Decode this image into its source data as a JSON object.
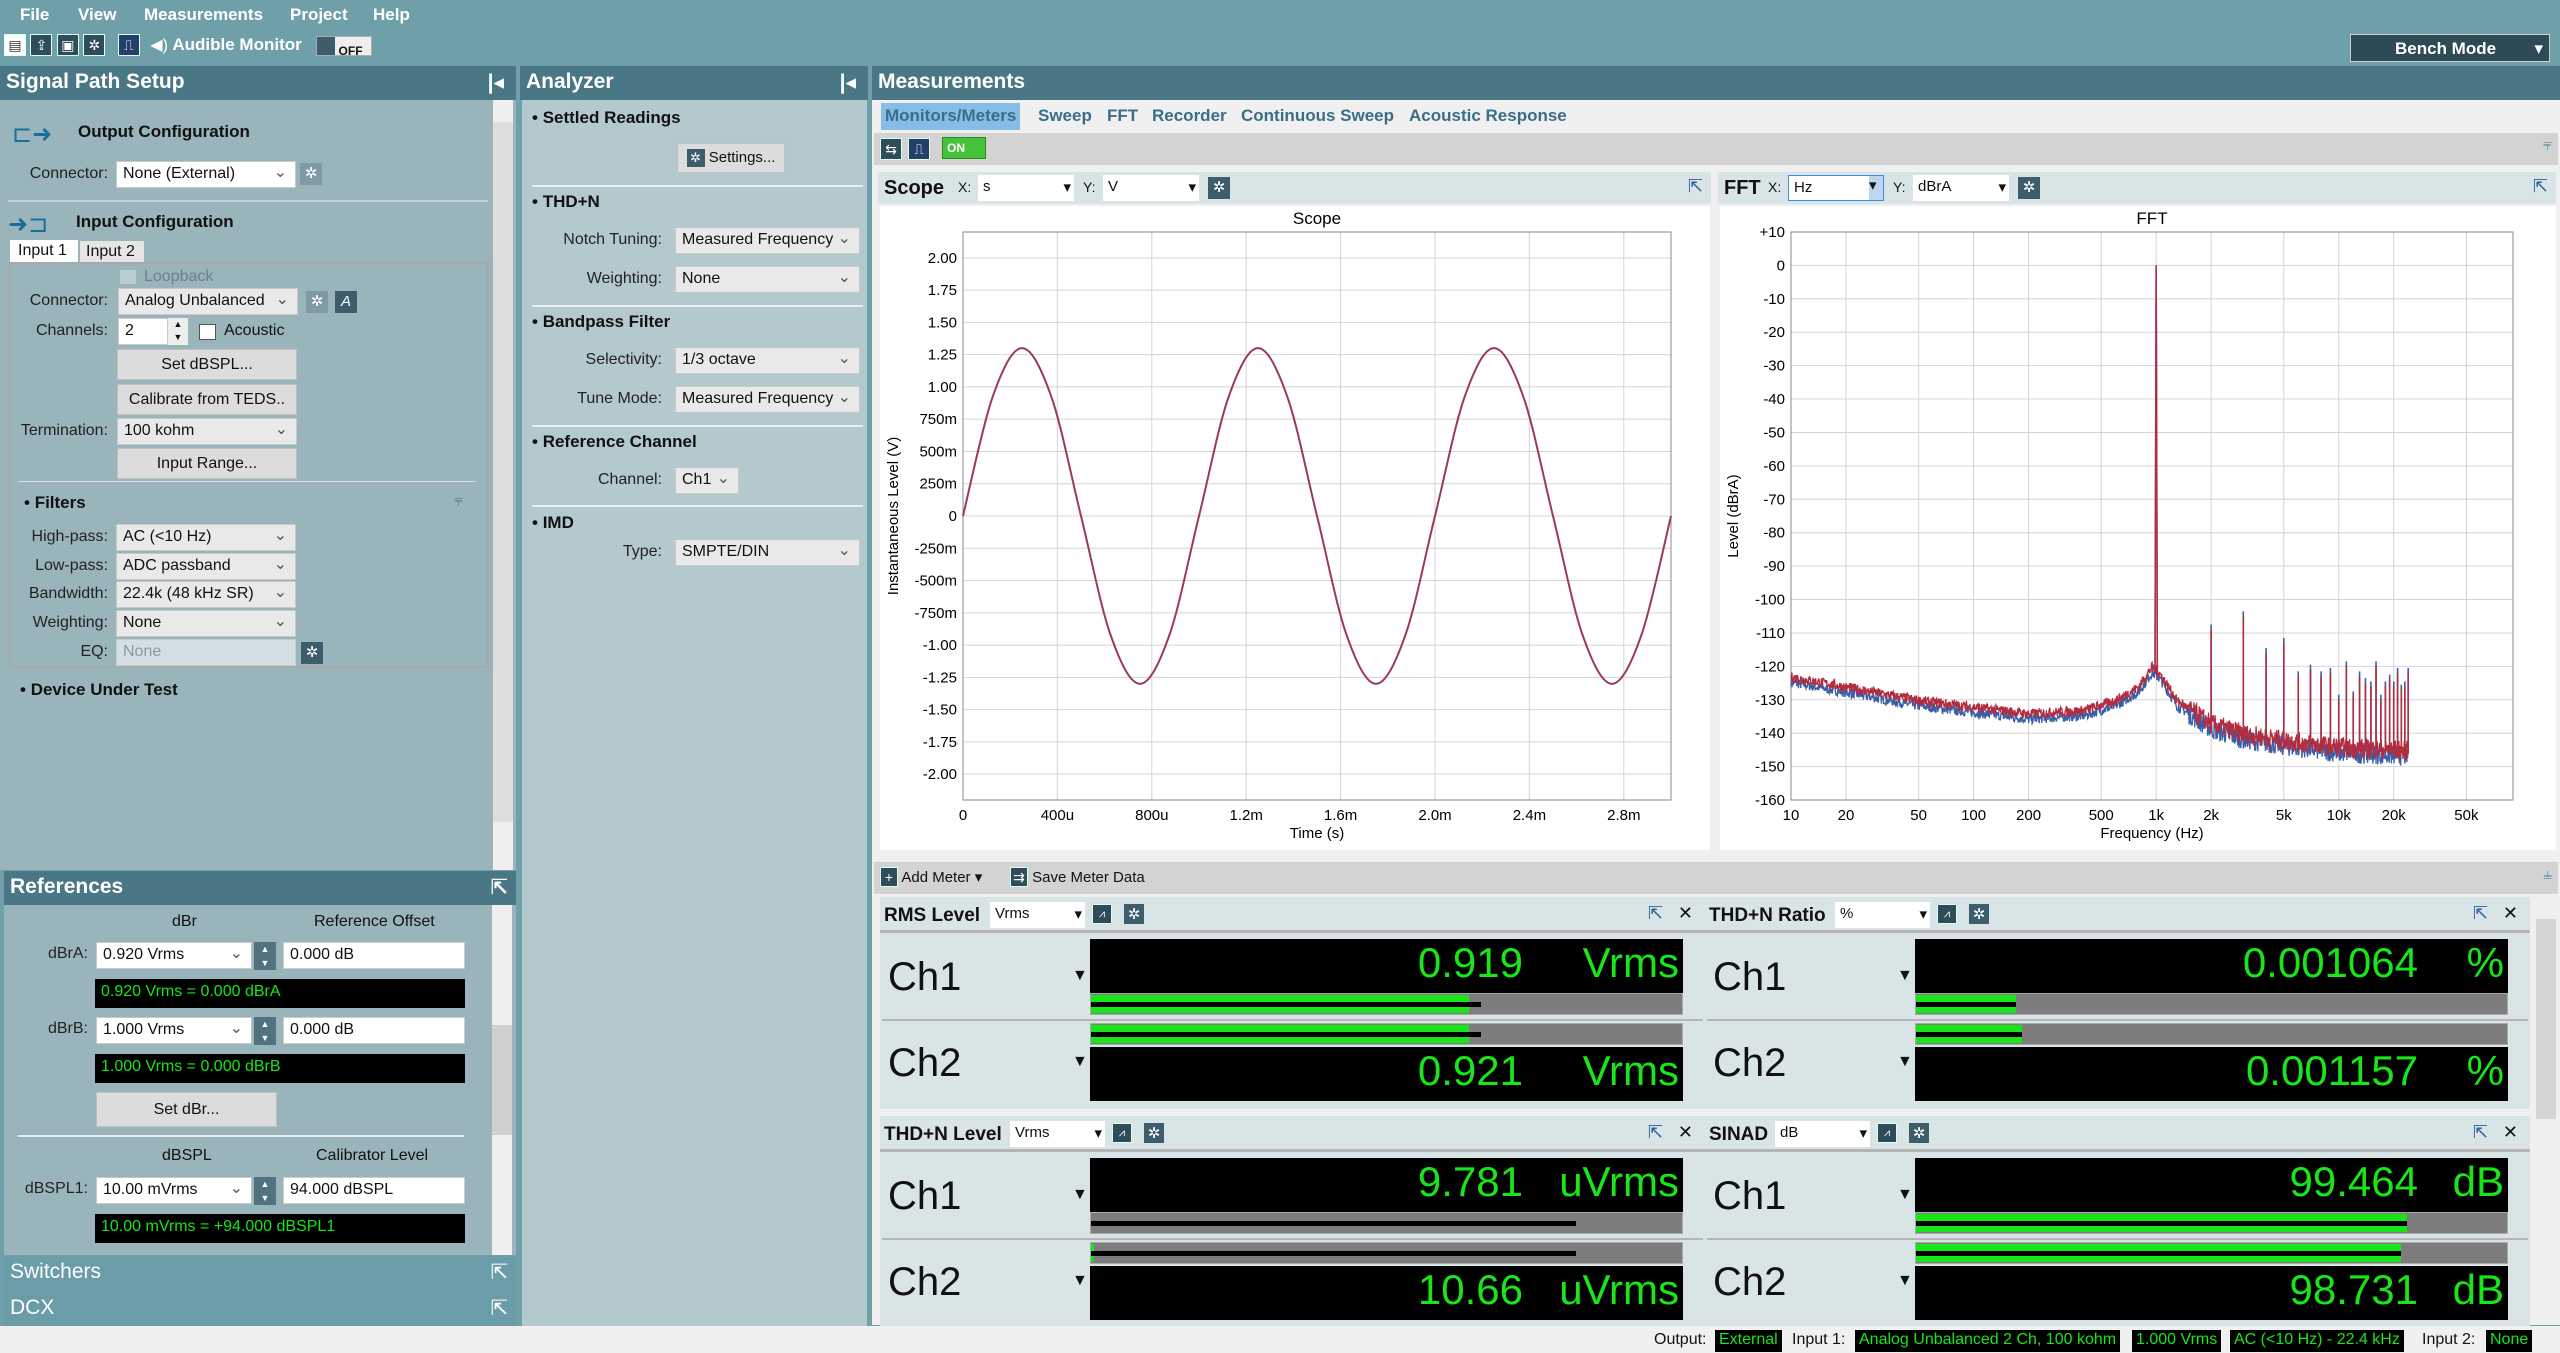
{
  "menu": [
    "File",
    "View",
    "Measurements",
    "Project",
    "Help"
  ],
  "toolbar": {
    "audible_monitor": "Audible Monitor",
    "monitor_toggle": "OFF",
    "mode": "Bench Mode",
    "icons": [
      "new-file-icon",
      "open-icon",
      "save-icon",
      "settings-icon",
      "generator-icon",
      "speaker-icon"
    ]
  },
  "signal_path": {
    "title": "Signal Path Setup",
    "output": {
      "title": "Output Configuration",
      "connector_label": "Connector:",
      "connector": "None (External)"
    },
    "input": {
      "title": "Input Configuration",
      "tabs": [
        "Input 1",
        "Input 2"
      ],
      "loopback": "Loopback",
      "connector_label": "Connector:",
      "connector": "Analog Unbalanced",
      "channels_label": "Channels:",
      "channels": "2",
      "acoustic": "Acoustic",
      "set_dbspl": "Set dBSPL...",
      "calibrate": "Calibrate from TEDS..",
      "termination_label": "Termination:",
      "termination": "100 kohm",
      "input_range": "Input Range..."
    },
    "filters": {
      "title": "Filters",
      "highpass_label": "High-pass:",
      "highpass": "AC (<10 Hz)",
      "lowpass_label": "Low-pass:",
      "lowpass": "ADC passband",
      "bandwidth_label": "Bandwidth:",
      "bandwidth": "22.4k (48 kHz SR)",
      "weighting_label": "Weighting:",
      "weighting": "None",
      "eq_label": "EQ:",
      "eq": "None"
    },
    "dut": "Device Under Test"
  },
  "references": {
    "title": "References",
    "col_dbr": "dBr",
    "col_offset": "Reference Offset",
    "dbra_label": "dBrA:",
    "dbra": "0.920 Vrms",
    "dbra_offset": "0.000 dB",
    "dbra_readout": "0.920 Vrms = 0.000 dBrA",
    "dbrb_label": "dBrB:",
    "dbrb": "1.000 Vrms",
    "dbrb_offset": "0.000 dB",
    "dbrb_readout": "1.000 Vrms = 0.000 dBrB",
    "set_dbr": "Set dBr...",
    "col_dbspl": "dBSPL",
    "col_cal": "Calibrator Level",
    "dbspl1_label": "dBSPL1:",
    "dbspl1": "10.00 mVrms",
    "dbspl1_cal": "94.000 dBSPL",
    "dbspl1_readout": "10.00 mVrms = +94.000 dBSPL1"
  },
  "switchers": "Switchers",
  "dcx": "DCX",
  "analyzer": {
    "title": "Analyzer",
    "settled": "Settled Readings",
    "settings": "Settings...",
    "thdn": "THD+N",
    "notch_label": "Notch Tuning:",
    "notch": "Measured Frequency",
    "weighting_label": "Weighting:",
    "weighting": "None",
    "bandpass": "Bandpass Filter",
    "selectivity_label": "Selectivity:",
    "selectivity": "1/3 octave",
    "tune_label": "Tune Mode:",
    "tune": "Measured Frequency",
    "refch": "Reference Channel",
    "channel_label": "Channel:",
    "channel": "Ch1",
    "imd": "IMD",
    "type_label": "Type:",
    "type": "SMPTE/DIN"
  },
  "measurements": {
    "title": "Measurements",
    "tabs": [
      "Monitors/Meters",
      "Sweep",
      "FFT",
      "Recorder",
      "Continuous Sweep",
      "Acoustic Response"
    ],
    "active_tab": "Monitors/Meters",
    "on_toggle": "ON",
    "scope": {
      "title": "Scope",
      "x_label": "X:",
      "x_unit": "s",
      "y_label": "Y:",
      "y_unit": "V"
    },
    "fft": {
      "title": "FFT",
      "x_label": "X:",
      "x_unit": "Hz",
      "y_label": "Y:",
      "y_unit": "dBrA"
    },
    "add_meter": "Add Meter",
    "save_meter": "Save Meter Data"
  },
  "meters": [
    {
      "title": "RMS Level",
      "unit_sel": "Vrms",
      "channels": [
        {
          "name": "Ch1",
          "value": "0.919",
          "unit": "Vrms",
          "bar": 0.64,
          "peak": 0.66
        },
        {
          "name": "Ch2",
          "value": "0.921",
          "unit": "Vrms",
          "bar": 0.64,
          "peak": 0.66
        }
      ]
    },
    {
      "title": "THD+N Ratio",
      "unit_sel": "%",
      "channels": [
        {
          "name": "Ch1",
          "value": "0.001064",
          "unit": "%",
          "bar": 0.17,
          "peak": 0.17
        },
        {
          "name": "Ch2",
          "value": "0.001157",
          "unit": "%",
          "bar": 0.18,
          "peak": 0.18
        }
      ]
    },
    {
      "title": "THD+N Level",
      "unit_sel": "Vrms",
      "channels": [
        {
          "name": "Ch1",
          "value": "9.781",
          "unit": "uVrms",
          "bar": 0,
          "peak": 0.82
        },
        {
          "name": "Ch2",
          "value": "10.66",
          "unit": "uVrms",
          "bar": 0.005,
          "peak": 0.82
        }
      ]
    },
    {
      "title": "SINAD",
      "unit_sel": "dB",
      "channels": [
        {
          "name": "Ch1",
          "value": "99.464",
          "unit": "dB",
          "bar": 0.83,
          "peak": 0.83
        },
        {
          "name": "Ch2",
          "value": "98.731",
          "unit": "dB",
          "bar": 0.82,
          "peak": 0.82
        }
      ]
    }
  ],
  "status": {
    "output_label": "Output:",
    "output": "External",
    "input1_label": "Input 1:",
    "input1": "Analog Unbalanced 2 Ch, 100 kohm",
    "input1_level": "1.000 Vrms",
    "input1_bw": "AC (<10 Hz) - 22.4 kHz",
    "input2_label": "Input 2:",
    "input2": "None"
  },
  "colors": {
    "ch1": "#3a5fa8",
    "ch2": "#b32d40",
    "meter_green": "#19e619",
    "panel_header": "#4a7785"
  },
  "chart_data": [
    {
      "type": "line",
      "title": "Scope",
      "xlabel": "Time (s)",
      "ylabel": "Instantaneous Level (V)",
      "xlim": [
        0,
        0.003
      ],
      "ylim": [
        -2.2,
        2.2
      ],
      "grid": true,
      "xticks": [
        [
          0,
          "0"
        ],
        [
          0.0004,
          "400u"
        ],
        [
          0.0008,
          "800u"
        ],
        [
          0.0012,
          "1.2m"
        ],
        [
          0.0016,
          "1.6m"
        ],
        [
          0.002,
          "2.0m"
        ],
        [
          0.0024,
          "2.4m"
        ],
        [
          0.0028,
          "2.8m"
        ]
      ],
      "yticks": [
        [
          2,
          "2.00"
        ],
        [
          1.75,
          "1.75"
        ],
        [
          1.5,
          "1.50"
        ],
        [
          1.25,
          "1.25"
        ],
        [
          1,
          "1.00"
        ],
        [
          0.75,
          "750m"
        ],
        [
          0.5,
          "500m"
        ],
        [
          0.25,
          "250m"
        ],
        [
          0,
          "0"
        ],
        [
          -0.25,
          "-250m"
        ],
        [
          -0.5,
          "-500m"
        ],
        [
          -0.75,
          "-750m"
        ],
        [
          -1,
          "-1.00"
        ],
        [
          -1.25,
          "-1.25"
        ],
        [
          -1.5,
          "-1.50"
        ],
        [
          -1.75,
          "-1.75"
        ],
        [
          -2,
          "-2.00"
        ]
      ],
      "x": [
        0,
        0.000125,
        0.00025,
        0.000375,
        0.0005,
        0.000625,
        0.00075,
        0.000875,
        0.001,
        0.001125,
        0.00125,
        0.001375,
        0.0015,
        0.001625,
        0.00175,
        0.001875,
        0.002,
        0.002125,
        0.00225,
        0.002375,
        0.0025,
        0.002625,
        0.00275,
        0.002875,
        0.003
      ],
      "series": [
        {
          "values": [
            0,
            0.92,
            1.3,
            0.92,
            0,
            -0.92,
            -1.3,
            -0.92,
            0,
            0.92,
            1.3,
            0.92,
            0,
            -0.92,
            -1.3,
            -0.92,
            0,
            0.92,
            1.3,
            0.92,
            0,
            -0.92,
            -1.3,
            -0.92,
            0
          ]
        }
      ]
    },
    {
      "type": "line",
      "title": "FFT",
      "xlabel": "Frequency (Hz)",
      "ylabel": "Level (dBrA)",
      "xscale": "log",
      "xlim": [
        10,
        90000
      ],
      "ylim": [
        -160,
        10
      ],
      "grid": true,
      "xticks": [
        [
          10,
          "10"
        ],
        [
          20,
          "20"
        ],
        [
          50,
          "50"
        ],
        [
          100,
          "100"
        ],
        [
          200,
          "200"
        ],
        [
          500,
          "500"
        ],
        [
          1000,
          "1k"
        ],
        [
          2000,
          "2k"
        ],
        [
          5000,
          "5k"
        ],
        [
          10000,
          "10k"
        ],
        [
          20000,
          "20k"
        ],
        [
          50000,
          "50k"
        ]
      ],
      "yticks": [
        [
          10,
          "+10"
        ],
        [
          0,
          "0"
        ],
        [
          -10,
          "-10"
        ],
        [
          -20,
          "-20"
        ],
        [
          -30,
          "-30"
        ],
        [
          -40,
          "-40"
        ],
        [
          -50,
          "-50"
        ],
        [
          -60,
          "-60"
        ],
        [
          -70,
          "-70"
        ],
        [
          -80,
          "-80"
        ],
        [
          -90,
          "-90"
        ],
        [
          -100,
          "-100"
        ],
        [
          -110,
          "-110"
        ],
        [
          -120,
          "-120"
        ],
        [
          -130,
          "-130"
        ],
        [
          -140,
          "-140"
        ],
        [
          -150,
          "-150"
        ],
        [
          -160,
          "-160"
        ]
      ],
      "noise_floor": [
        [
          10,
          -124
        ],
        [
          20,
          -127
        ],
        [
          50,
          -131
        ],
        [
          100,
          -133
        ],
        [
          200,
          -135
        ],
        [
          400,
          -134
        ],
        [
          600,
          -131
        ],
        [
          800,
          -127
        ],
        [
          950,
          -121
        ],
        [
          1050,
          -123
        ],
        [
          1300,
          -131
        ],
        [
          2000,
          -138
        ],
        [
          3000,
          -141
        ],
        [
          5000,
          -143
        ],
        [
          10000,
          -145
        ],
        [
          24000,
          -146
        ]
      ],
      "fundamental": [
        1000,
        0
      ],
      "harmonics": [
        [
          2000,
          -109
        ],
        [
          3000,
          -105
        ],
        [
          4000,
          -116
        ],
        [
          5000,
          -113
        ],
        [
          6000,
          -123
        ],
        [
          7000,
          -121
        ],
        [
          8000,
          -123
        ],
        [
          9000,
          -122
        ],
        [
          10000,
          -130
        ],
        [
          11000,
          -120
        ],
        [
          12000,
          -129
        ],
        [
          13000,
          -123
        ],
        [
          14000,
          -125
        ],
        [
          15000,
          -126
        ],
        [
          16000,
          -120
        ],
        [
          17000,
          -130
        ],
        [
          18000,
          -126
        ],
        [
          19000,
          -124
        ],
        [
          20000,
          -126
        ],
        [
          21000,
          -122
        ],
        [
          22000,
          -127
        ],
        [
          23000,
          -126
        ],
        [
          24000,
          -122
        ]
      ],
      "series": [
        {
          "color": "#3a5fa8"
        },
        {
          "color": "#b32d40"
        }
      ]
    }
  ]
}
